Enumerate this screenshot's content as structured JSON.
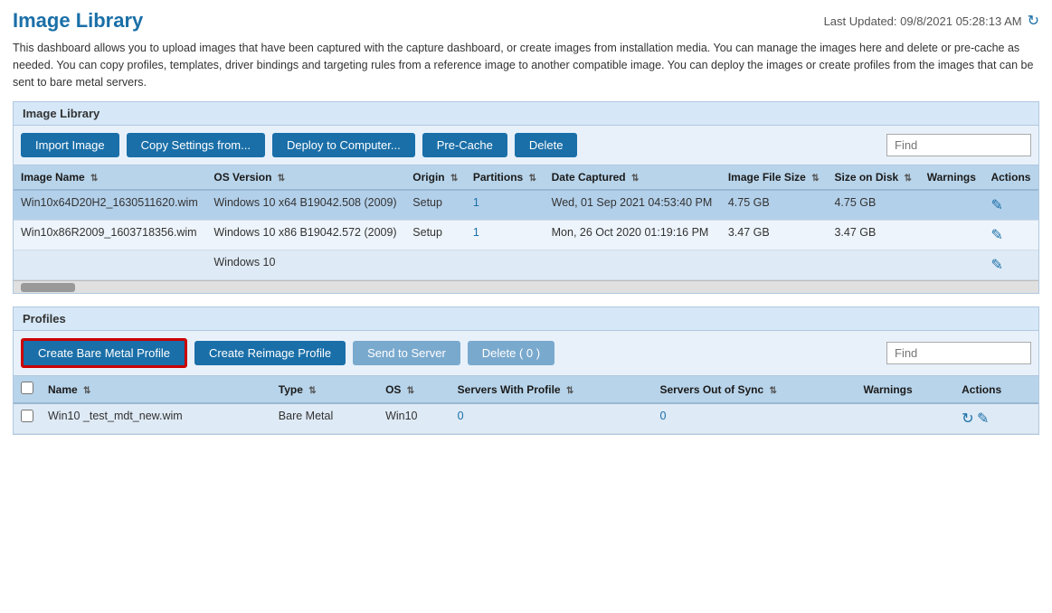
{
  "page": {
    "title": "Image Library",
    "last_updated_label": "Last Updated: 09/8/2021 05:28:13 AM"
  },
  "description": "This dashboard allows you to upload images that have been captured with the capture dashboard, or create images from installation media. You can manage the images here and delete or pre-cache as needed. You can copy profiles, templates, driver bindings and targeting rules from a reference image to another compatible image. You can deploy the images or create profiles from the images that can be sent to bare metal servers.",
  "image_library": {
    "panel_title": "Image Library",
    "toolbar": {
      "import_label": "Import Image",
      "copy_settings_label": "Copy Settings from...",
      "deploy_label": "Deploy to Computer...",
      "precache_label": "Pre-Cache",
      "delete_label": "Delete",
      "find_placeholder": "Find"
    },
    "columns": [
      {
        "key": "image_name",
        "label": "Image Name"
      },
      {
        "key": "os_version",
        "label": "OS Version"
      },
      {
        "key": "origin",
        "label": "Origin"
      },
      {
        "key": "partitions",
        "label": "Partitions"
      },
      {
        "key": "date_captured",
        "label": "Date Captured"
      },
      {
        "key": "image_file_size",
        "label": "Image File Size"
      },
      {
        "key": "size_on_disk",
        "label": "Size on Disk"
      },
      {
        "key": "warnings",
        "label": "Warnings"
      },
      {
        "key": "actions",
        "label": "Actions"
      }
    ],
    "rows": [
      {
        "image_name": "Win10x64D20H2_1630511620.wim",
        "os_version": "Windows 10 x64 B19042.508 (2009)",
        "origin": "Setup",
        "partitions": "1",
        "date_captured": "Wed, 01 Sep 2021 04:53:40 PM",
        "image_file_size": "4.75 GB",
        "size_on_disk": "4.75 GB",
        "warnings": "",
        "selected": true
      },
      {
        "image_name": "Win10x86R2009_1603718356.wim",
        "os_version": "Windows 10 x86 B19042.572 (2009)",
        "origin": "Setup",
        "partitions": "1",
        "date_captured": "Mon, 26 Oct 2020 01:19:16 PM",
        "image_file_size": "3.47 GB",
        "size_on_disk": "3.47 GB",
        "warnings": "",
        "selected": false
      },
      {
        "image_name": "",
        "os_version": "Windows 10",
        "origin": "",
        "partitions": "",
        "date_captured": "",
        "image_file_size": "",
        "size_on_disk": "",
        "warnings": "",
        "selected": false
      }
    ]
  },
  "profiles": {
    "panel_title": "Profiles",
    "toolbar": {
      "create_bare_metal_label": "Create Bare Metal Profile",
      "create_reimage_label": "Create Reimage Profile",
      "send_to_server_label": "Send to Server",
      "delete_label": "Delete ( 0 )",
      "find_placeholder": "Find"
    },
    "columns": [
      {
        "key": "checkbox",
        "label": ""
      },
      {
        "key": "name",
        "label": "Name"
      },
      {
        "key": "type",
        "label": "Type"
      },
      {
        "key": "os",
        "label": "OS"
      },
      {
        "key": "servers_with_profile",
        "label": "Servers With Profile"
      },
      {
        "key": "servers_out_of_sync",
        "label": "Servers Out of Sync"
      },
      {
        "key": "warnings",
        "label": "Warnings"
      },
      {
        "key": "actions",
        "label": "Actions"
      }
    ],
    "rows": [
      {
        "name": "Win10 _test_mdt_new.wim",
        "type": "Bare Metal",
        "os": "Win10",
        "servers_with_profile": "0",
        "servers_out_of_sync": "0",
        "warnings": ""
      }
    ]
  }
}
